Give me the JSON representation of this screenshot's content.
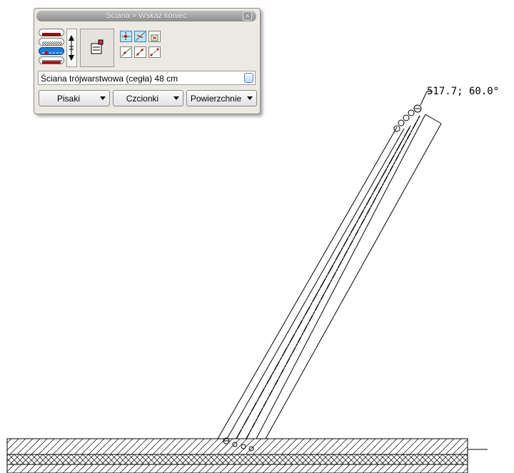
{
  "panel": {
    "title": "Ściana » Wskaż koniec",
    "close_icon": "close-icon",
    "wall_type": "Ściana trójwarstwowa (cegła) 48 cm",
    "dropdowns": [
      {
        "label": "Pisaki"
      },
      {
        "label": "Czcionki"
      },
      {
        "label": "Powierzchnie"
      }
    ],
    "icons": {
      "swap": "swap-direction-icon",
      "properties": "wall-properties-icon",
      "modes": [
        "axis-mode-icon",
        "left-face-mode-icon",
        "rectangle-mode-icon",
        "diagonal-mode-icon",
        "arc-mode-icon",
        "polyline-mode-icon"
      ]
    }
  },
  "drawing": {
    "coordinate_readout": "517.7; 60.0°",
    "colors": {
      "line": "#000000",
      "background": "#ffffff",
      "active": "#bfe3fb"
    }
  }
}
